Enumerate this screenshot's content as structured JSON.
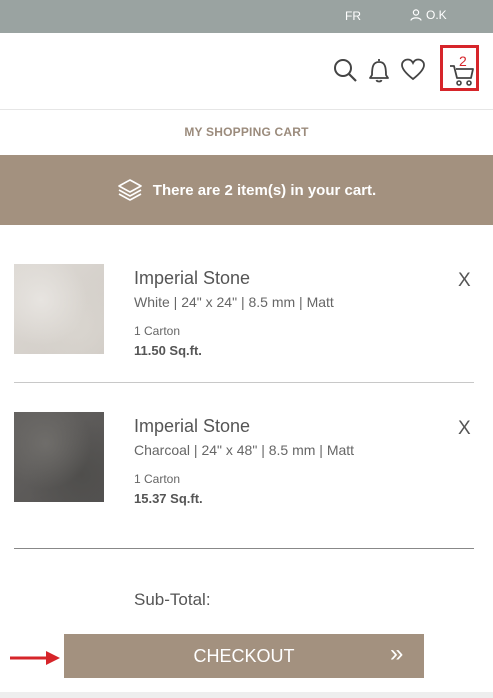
{
  "topbar": {
    "language": "FR",
    "user_name": "O.K"
  },
  "header": {
    "cart_count": "2"
  },
  "cart": {
    "title": "MY SHOPPING CART",
    "banner": "There are 2 item(s) in your cart."
  },
  "items": [
    {
      "name": "Imperial Stone",
      "spec": "White | 24\" x 24\" | 8.5 mm | Matt",
      "quantity": "1 Carton",
      "area": "11.50 Sq.ft.",
      "remove_label": "X"
    },
    {
      "name": "Imperial Stone",
      "spec": "Charcoal | 24\" x 48\" | 8.5 mm | Matt",
      "quantity": "1 Carton",
      "area": "15.37 Sq.ft.",
      "remove_label": "X"
    }
  ],
  "summary": {
    "subtotal_label": "Sub-Total:",
    "checkout_label": "CHECKOUT",
    "checkout_chevron": "»"
  },
  "colors": {
    "topbar": "#9aa3a1",
    "accent": "#a3917f",
    "highlight": "#d6252a"
  },
  "icons": [
    "user-icon",
    "search-icon",
    "bell-icon",
    "heart-icon",
    "cart-icon",
    "layers-icon",
    "arrow-icon"
  ]
}
